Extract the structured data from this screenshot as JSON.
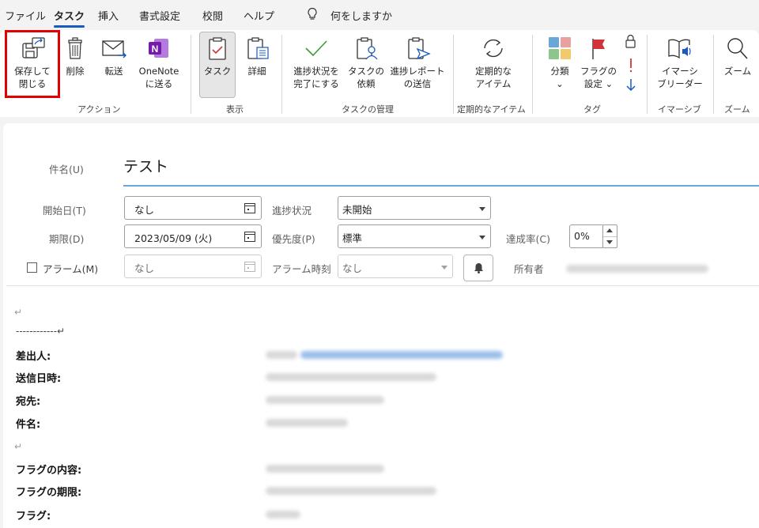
{
  "menu": {
    "items": [
      "ファイル",
      "タスク",
      "挿入",
      "書式設定",
      "校閲",
      "ヘルプ"
    ],
    "active": "タスク",
    "search_placeholder": "何をしますか"
  },
  "ribbon": {
    "actions": {
      "save_close": "保存して\n閉じる",
      "delete": "削除",
      "forward": "転送",
      "onenote": "OneNote\nに送る",
      "group_label": "アクション"
    },
    "show": {
      "task": "タスク",
      "details": "詳細",
      "group_label": "表示"
    },
    "manage": {
      "mark_complete": "進捗状況を\n完了にする",
      "assign": "タスクの\n依頼",
      "send_status": "進捗レポート\nの送信",
      "group_label": "タスクの管理"
    },
    "recurrence": {
      "recurrence": "定期的な\nアイテム",
      "group_label": "定期的なアイテム"
    },
    "tags": {
      "categorize": "分類\n⌄",
      "follow_up": "フラグの\n設定 ⌄",
      "group_label": "タグ"
    },
    "immersive": {
      "reader": "イマーシ\nブリーダー",
      "group_label": "イマーシブ"
    },
    "zoom": {
      "zoom": "ズーム",
      "group_label": "ズーム"
    }
  },
  "form": {
    "subject_label": "件名(U)",
    "subject_value": "テスト",
    "start_label": "開始日(T)",
    "start_value": "なし",
    "status_label": "進捗状況",
    "status_value": "未開始",
    "due_label": "期限(D)",
    "due_value": "2023/05/09 (火)",
    "priority_label": "優先度(P)",
    "priority_value": "標準",
    "percent_label": "達成率(C)",
    "percent_value": "0%",
    "reminder_label": "アラーム(M)",
    "reminder_date": "なし",
    "reminder_time_label": "アラーム時刻",
    "reminder_time_value": "なし",
    "owner_label": "所有者"
  },
  "body": {
    "separator": "------------↵",
    "return_mark": "↵",
    "from_label": "差出人:",
    "sent_label": "送信日時:",
    "to_label": "宛先:",
    "subject_label": "件名:",
    "flag_content_label": "フラグの内容:",
    "flag_due_label": "フラグの期限:",
    "flag_label": "フラグ:"
  },
  "colors": {
    "accent": "#185abd",
    "highlight": "#e30000",
    "complete_check": "#3a9a3a",
    "flag_red": "#d13438",
    "onenote": "#7719aa"
  }
}
